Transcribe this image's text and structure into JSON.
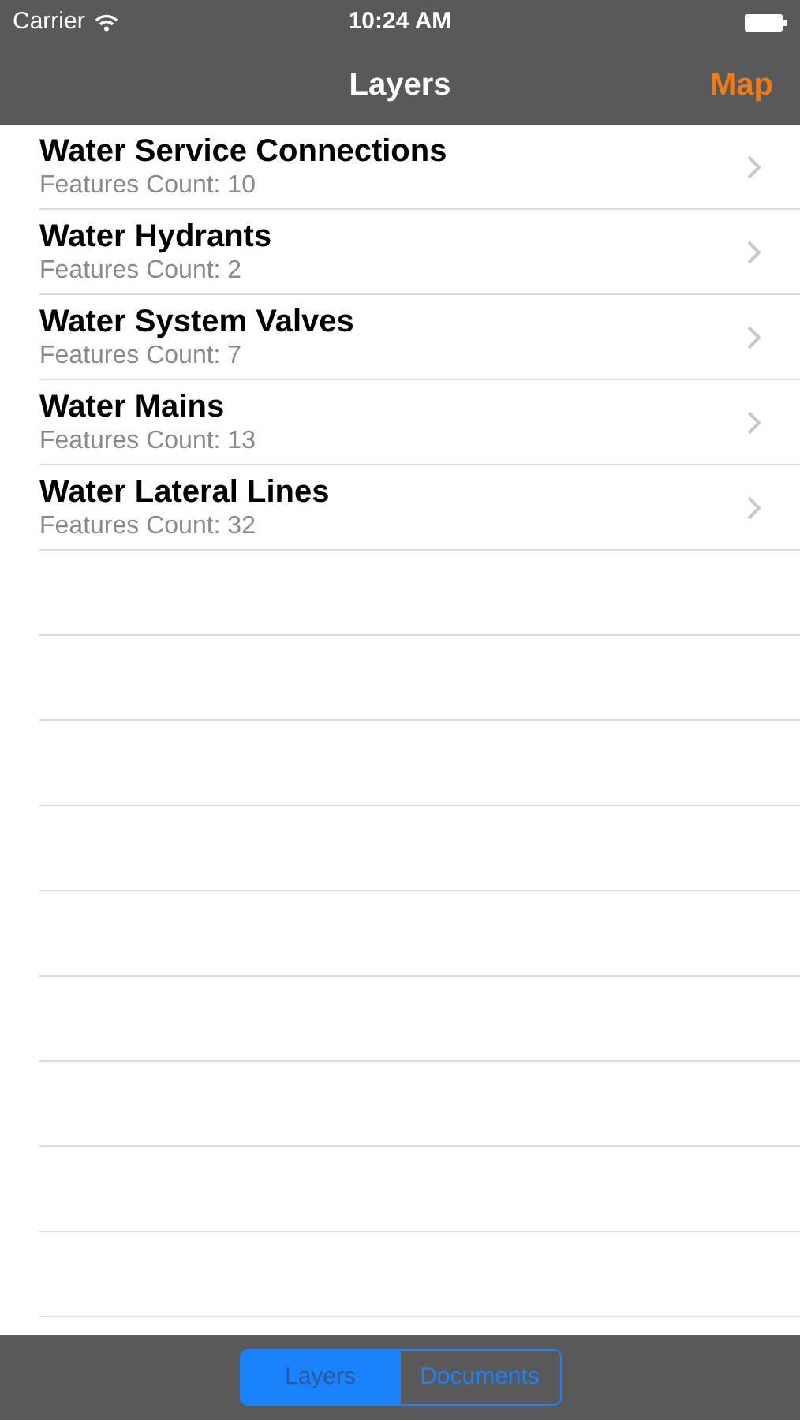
{
  "status_bar": {
    "carrier": "Carrier",
    "time": "10:24 AM"
  },
  "nav_bar": {
    "title": "Layers",
    "right_button": "Map"
  },
  "layers": [
    {
      "name": "Water Service Connections",
      "count": "Features Count: 10"
    },
    {
      "name": "Water Hydrants",
      "count": "Features Count: 2"
    },
    {
      "name": "Water System Valves",
      "count": "Features Count: 7"
    },
    {
      "name": "Water Mains",
      "count": "Features Count: 13"
    },
    {
      "name": "Water Lateral Lines",
      "count": "Features Count: 32"
    }
  ],
  "segments": [
    {
      "label": "Layers",
      "selected": true
    },
    {
      "label": "Documents",
      "selected": false
    }
  ]
}
